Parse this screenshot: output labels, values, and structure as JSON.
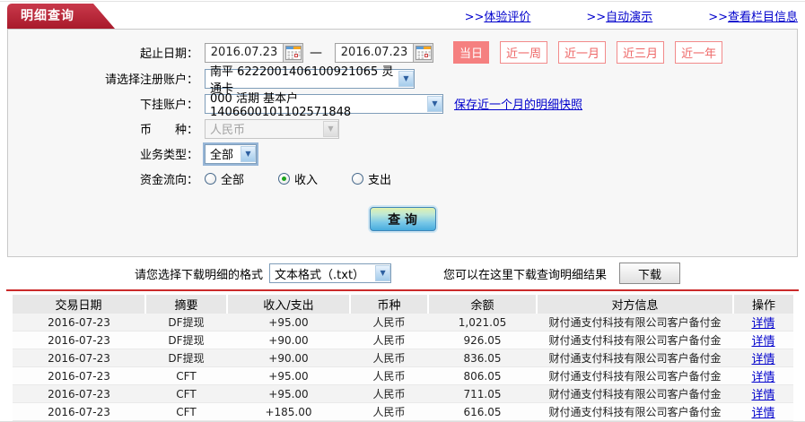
{
  "page": {
    "tab_title": "明细查询",
    "nav_links": [
      {
        "prefix": ">>",
        "label": "体验评价"
      },
      {
        "prefix": ">>",
        "label": "自动演示"
      },
      {
        "prefix": ">>",
        "label": "查看栏目信息"
      }
    ]
  },
  "form": {
    "date_label": "起止日期：",
    "date_from": "2016.07.23",
    "date_to": "2016.07.23",
    "date_dash": "—",
    "quick_ranges": [
      {
        "label": "当日",
        "active": true
      },
      {
        "label": "近一周",
        "active": false
      },
      {
        "label": "近一月",
        "active": false
      },
      {
        "label": "近三月",
        "active": false
      },
      {
        "label": "近一年",
        "active": false
      }
    ],
    "registered_account_label": "请选择注册账户：",
    "registered_account_value": "南平  6222001406100921065  灵通卡",
    "sub_account_label": "下挂账户：",
    "sub_account_value": "000 活期 基本户 1406600101102571848",
    "snapshot_link": "保存近一个月的明细快照",
    "currency_label": "币　　种：",
    "currency_value": "人民币",
    "business_type_label": "业务类型：",
    "business_type_value": "全部",
    "flow_label": "资金流向：",
    "flow_options": [
      {
        "label": "全部",
        "checked": false
      },
      {
        "label": "收入",
        "checked": true
      },
      {
        "label": "支出",
        "checked": false
      }
    ],
    "query_button_label": "查 询"
  },
  "download": {
    "format_label": "请您选择下载明细的格式",
    "format_value": "文本格式（.txt）",
    "hint": "您可以在这里下载查询明细结果",
    "button_label": "下载"
  },
  "table": {
    "headers": [
      "交易日期",
      "摘要",
      "收入/支出",
      "币种",
      "余额",
      "对方信息",
      "操作"
    ],
    "rows": [
      {
        "date": "2016-07-23",
        "summary": "DF提现",
        "amount": "+95.00",
        "currency": "人民币",
        "balance": "1,021.05",
        "counterparty": "财付通支付科技有限公司客户备付金",
        "action": "详情"
      },
      {
        "date": "2016-07-23",
        "summary": "DF提现",
        "amount": "+90.00",
        "currency": "人民币",
        "balance": "926.05",
        "counterparty": "财付通支付科技有限公司客户备付金",
        "action": "详情"
      },
      {
        "date": "2016-07-23",
        "summary": "DF提现",
        "amount": "+90.00",
        "currency": "人民币",
        "balance": "836.05",
        "counterparty": "财付通支付科技有限公司客户备付金",
        "action": "详情"
      },
      {
        "date": "2016-07-23",
        "summary": "CFT",
        "amount": "+95.00",
        "currency": "人民币",
        "balance": "806.05",
        "counterparty": "财付通支付科技有限公司客户备付金",
        "action": "详情"
      },
      {
        "date": "2016-07-23",
        "summary": "CFT",
        "amount": "+95.00",
        "currency": "人民币",
        "balance": "711.05",
        "counterparty": "财付通支付科技有限公司客户备付金",
        "action": "详情"
      },
      {
        "date": "2016-07-23",
        "summary": "CFT",
        "amount": "+185.00",
        "currency": "人民币",
        "balance": "616.05",
        "counterparty": "财付通支付科技有限公司客户备付金",
        "action": "详情"
      }
    ]
  },
  "colors": {
    "tab_red": "#a81a2b",
    "quick_button_red": "#f58080",
    "link_blue": "#0000cc",
    "amount_red": "#cc0000",
    "divider_red": "#cb2a2a",
    "query_button_blue": "#47acdd"
  }
}
